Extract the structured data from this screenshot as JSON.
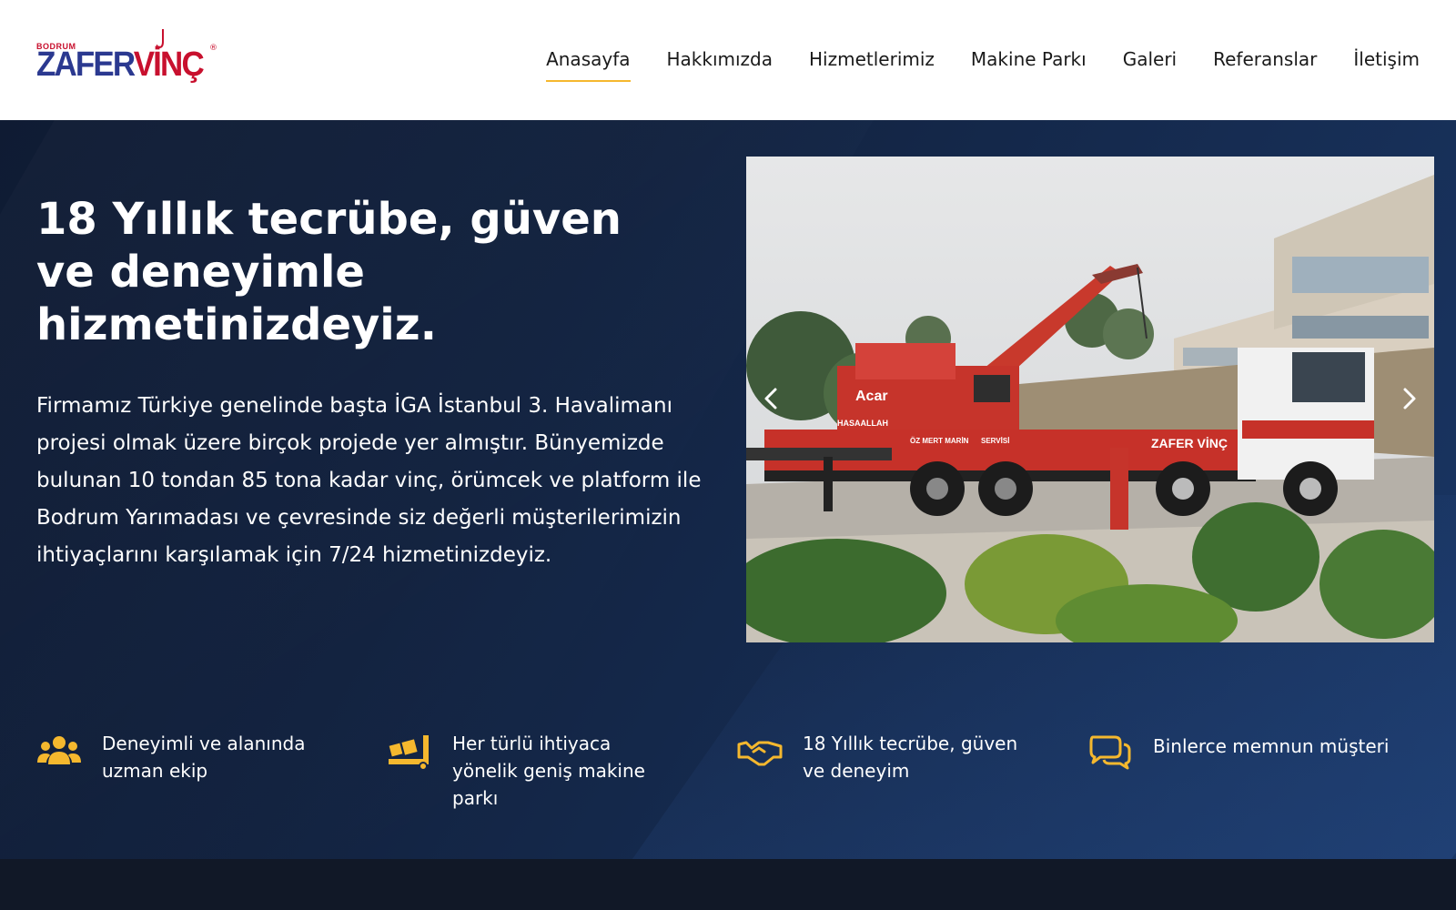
{
  "brand": {
    "small": "BODRUM",
    "name_part1": "ZAFER",
    "name_part2": "VİNÇ",
    "registered": "®",
    "colors": {
      "blue": "#2b3990",
      "red": "#c8102e"
    }
  },
  "nav": {
    "items": [
      {
        "label": "Anasayfa",
        "active": true
      },
      {
        "label": "Hakkımızda",
        "active": false
      },
      {
        "label": "Hizmetlerimiz",
        "active": false
      },
      {
        "label": "Makine Parkı",
        "active": false
      },
      {
        "label": "Galeri",
        "active": false
      },
      {
        "label": "Referanslar",
        "active": false
      },
      {
        "label": "İletişim",
        "active": false
      }
    ],
    "active_underline_color": "#f5b82e"
  },
  "hero": {
    "title": "18 Yıllık tecrübe, güven ve deneyimle hizmetinizdeyiz.",
    "text": "Firmamız Türkiye genelinde başta İGA İstanbul 3. Havalimanı projesi olmak üzere birçok projede yer almıştır. Bünyemizde bulunan 10 tondan 85 tona kadar vinç, örümcek ve platform ile Bodrum Yarımadası ve çevresinde siz değerli müşterilerimizin ihtiyaçlarını karşılamak için 7/24 hizmetinizdeyiz.",
    "slider": {
      "image_icon": "crane-truck-photo",
      "truck_labels": [
        "ZAFER VİNÇ",
        "Acar",
        "ÖZ MERT MARİN",
        "SERVİSİ",
        "HASAALLAH"
      ],
      "prev_icon": "chevron-left-icon",
      "next_icon": "chevron-right-icon"
    }
  },
  "features": [
    {
      "icon": "users-icon",
      "text": "Deneyimli ve alanında uzman ekip"
    },
    {
      "icon": "truck-loading-icon",
      "text": "Her türlü ihtiyaca yönelik geniş makine parkı"
    },
    {
      "icon": "handshake-icon",
      "text": "18 Yıllık tecrübe, güven ve deneyim"
    },
    {
      "icon": "comments-icon",
      "text": "Binlerce memnun müşteri"
    }
  ],
  "accent_color": "#f5b82e"
}
